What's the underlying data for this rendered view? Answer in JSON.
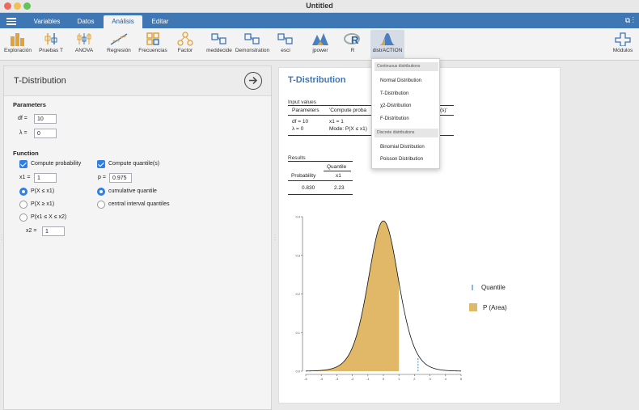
{
  "window": {
    "title": "Untitled"
  },
  "menubar": {
    "tabs": [
      {
        "label": "Variables"
      },
      {
        "label": "Datos"
      },
      {
        "label": "Análisis"
      },
      {
        "label": "Editar"
      }
    ]
  },
  "ribbon": {
    "buttons": [
      {
        "label": "Exploración",
        "icon": "exploration-icon"
      },
      {
        "label": "Pruebas T",
        "icon": "t-tests-icon"
      },
      {
        "label": "ANOVA",
        "icon": "anova-icon"
      },
      {
        "label": "Regresión",
        "icon": "regression-icon"
      },
      {
        "label": "Frecuencias",
        "icon": "frequencies-icon"
      },
      {
        "label": "Factor",
        "icon": "factor-icon"
      },
      {
        "label": "meddecide",
        "icon": "meddecide-icon"
      },
      {
        "label": "Demonstration",
        "icon": "demonstration-icon"
      },
      {
        "label": "esci",
        "icon": "esci-icon"
      },
      {
        "label": "jpower",
        "icon": "jpower-icon"
      },
      {
        "label": "R",
        "icon": "r-icon"
      },
      {
        "label": "distrACTION",
        "icon": "distraction-icon"
      }
    ],
    "modules_label": "Módulos"
  },
  "left_panel": {
    "title": "T-Distribution",
    "parameters": {
      "heading": "Parameters",
      "df_label": "df =",
      "df_value": "10",
      "lambda_label": "λ =",
      "lambda_value": "0"
    },
    "function": {
      "heading": "Function",
      "compute_probability_label": "Compute probability",
      "compute_quantile_label": "Compute quantile(s)",
      "x1_label": "x1 =",
      "x1_value": "1",
      "p_label": "p =",
      "p_value": "0.975",
      "opt_le": "P(X ≤ x1)",
      "opt_ge": "P(X ≥ x1)",
      "opt_between": "P(x1 ≤ X ≤ x2)",
      "x2_label": "x2 =",
      "x2_value": "1",
      "cumulative_quantile": "cumulative quantile",
      "central_interval": "central interval quantiles"
    }
  },
  "output": {
    "title": "T-Distribution",
    "input_values_heading": "Input values",
    "input_headers": {
      "parameters": "Parameters",
      "compute_prob": "'Compute proba",
      "compute_quant_tail": "(s)'"
    },
    "input_rows": {
      "df": "df = 10",
      "x1": "x1 = 1",
      "lambda": "λ = 0",
      "mode": "Mode: P(X ≤ x1)"
    },
    "results_heading": "Results",
    "results_headers": {
      "quantile": "Quantile",
      "probability": "Probability",
      "x1": "x1"
    },
    "results_values": {
      "probability": "0.830",
      "quantile": "2.23"
    },
    "legend": {
      "quantile": "Quantile",
      "area": "P (Area)"
    }
  },
  "dropdown": {
    "continuous_heading": "Continuous distributions",
    "continuous_items": [
      "Normal Distribution",
      "T-Distribution",
      "χ2-Distribution",
      "F-Distribution"
    ],
    "discrete_heading": "Discrete distributions",
    "discrete_items": [
      "Binomial Distribution",
      "Poisson Distribution"
    ]
  },
  "colors": {
    "accent": "#3f76b4",
    "area_fill": "#e0b868",
    "checkbox": "#2d7ee6",
    "quantile_line": "#6b9fd6"
  },
  "chart_data": {
    "type": "area",
    "title": "",
    "xlabel": "",
    "ylabel": "",
    "distribution": "t",
    "df": 10,
    "x_ticks": [
      -5,
      -4,
      -3,
      -2,
      -1,
      0,
      1,
      2,
      3,
      4,
      5
    ],
    "y_ticks": [
      0.0,
      0.1,
      0.2,
      0.3,
      0.4
    ],
    "xlim": [
      -5,
      5
    ],
    "ylim": [
      0,
      0.4
    ],
    "shaded_area": {
      "from": -5,
      "to": 1,
      "probability": 0.83
    },
    "quantile": 2.23,
    "series": [
      {
        "name": "Quantile",
        "type": "dashed-line",
        "x": 2.23
      },
      {
        "name": "P (Area)",
        "type": "area"
      }
    ],
    "legend_position": "right"
  }
}
